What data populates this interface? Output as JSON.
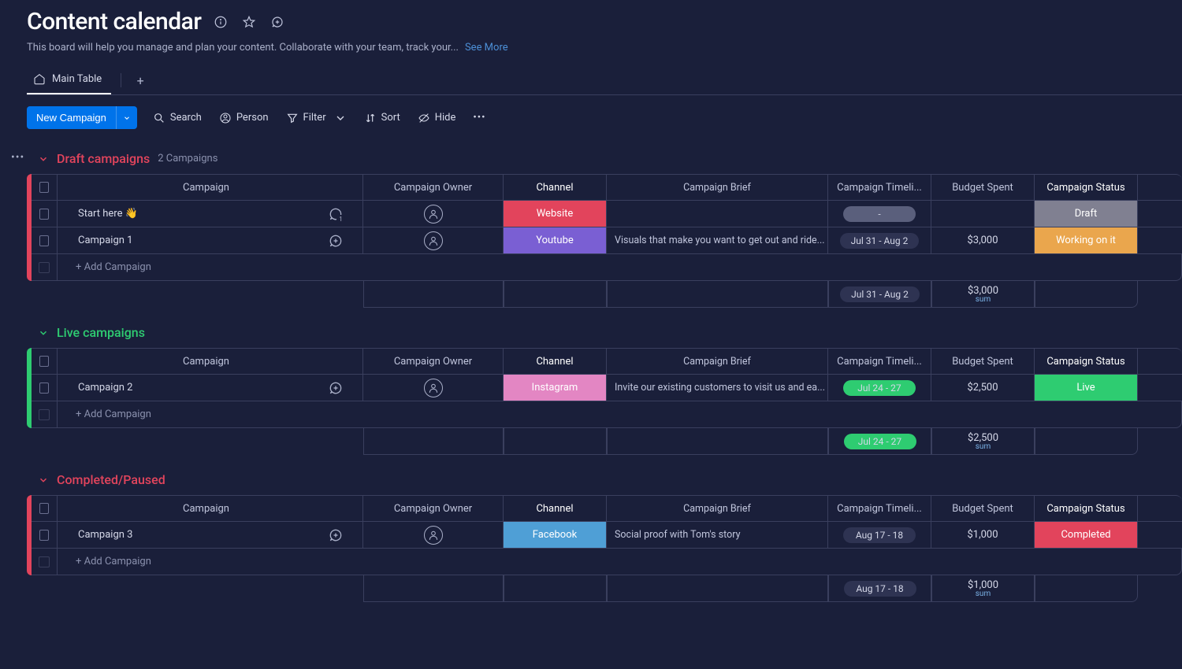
{
  "title": "Content calendar",
  "description": "This board will help you manage and plan your content. Collaborate with your team, track your...",
  "see_more": "See More",
  "views": {
    "main": "Main Table"
  },
  "toolbar": {
    "new": "New Campaign",
    "search": "Search",
    "person": "Person",
    "filter": "Filter",
    "sort": "Sort",
    "hide": "Hide"
  },
  "columns": {
    "campaign": "Campaign",
    "owner": "Campaign Owner",
    "channel": "Channel",
    "brief": "Campaign Brief",
    "timeline": "Campaign Timeli...",
    "budget": "Budget Spent",
    "status": "Campaign Status"
  },
  "add_row": "+ Add Campaign",
  "sum_label": "sum",
  "groups": [
    {
      "id": "draft",
      "name": "Draft campaigns",
      "count": "2 Campaigns",
      "color": "#e2445c",
      "title_color": "#e2445c",
      "rows": [
        {
          "name": "Start here 👋",
          "chat_count": "1",
          "channel": "Website",
          "channel_bg": "#e2445c",
          "brief": "",
          "timeline": "-",
          "timeline_bg": "#5a5f7c",
          "budget": "",
          "status": "Draft",
          "status_bg": "#808091"
        },
        {
          "name": "Campaign 1",
          "channel": "Youtube",
          "channel_bg": "#7a5fd3",
          "brief": "Visuals that make you want to get out and ride...",
          "timeline": "Jul 31 - Aug 2",
          "timeline_bg": "#2e3352",
          "budget": "$3,000",
          "status": "Working on it",
          "status_bg": "#eaa64d"
        }
      ],
      "footer": {
        "timeline": "Jul 31 - Aug 2",
        "budget": "$3,000"
      }
    },
    {
      "id": "live",
      "name": "Live campaigns",
      "color": "#2ecc71",
      "title_color": "#2ecc71",
      "rows": [
        {
          "name": "Campaign 2",
          "channel": "Instagram",
          "channel_bg": "#e386c3",
          "brief": "Invite our existing customers to visit us and ea...",
          "timeline": "Jul 24 - 27",
          "timeline_bg": "#2ecc71",
          "budget": "$2,500",
          "status": "Live",
          "status_bg": "#2ecc71"
        }
      ],
      "footer": {
        "timeline": "Jul 24 - 27",
        "timeline_bg": "#2ecc71",
        "budget": "$2,500"
      }
    },
    {
      "id": "completed",
      "name": "Completed/Paused",
      "color": "#e2445c",
      "title_color": "#e2445c",
      "rows": [
        {
          "name": "Campaign 3",
          "channel": "Facebook",
          "channel_bg": "#4f9fd6",
          "brief": "Social proof with Tom's story",
          "timeline": "Aug 17 - 18",
          "timeline_bg": "#2e3352",
          "budget": "$1,000",
          "status": "Completed",
          "status_bg": "#e2445c"
        }
      ],
      "footer": {
        "timeline": "Aug 17 - 18",
        "budget": "$1,000"
      }
    }
  ]
}
